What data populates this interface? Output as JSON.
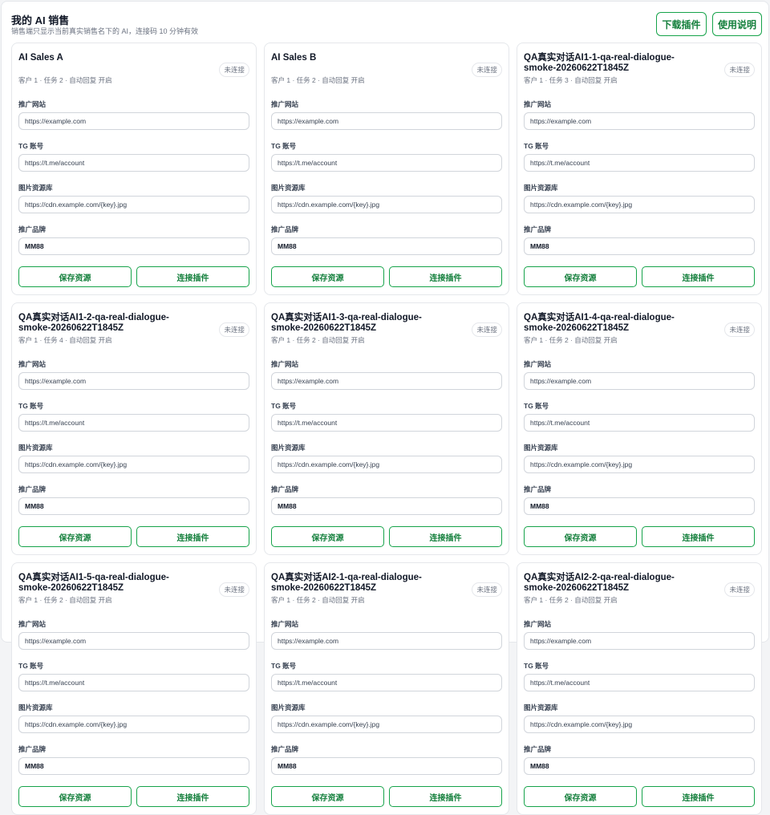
{
  "header": {
    "title": "我的 AI 销售",
    "subtitle": "销售端只显示当前真实销售名下的 AI，连接码 10 分钟有效",
    "download_label": "下载插件",
    "help_label": "使用说明"
  },
  "labels": {
    "promo_site": "推广网站",
    "tg_account": "TG 账号",
    "image_repo": "图片资源库",
    "brand": "推广品牌",
    "save": "保存资源",
    "connect": "连接插件"
  },
  "colors": {
    "accent": "#16a34a"
  },
  "cards": [
    {
      "title": "AI Sales A",
      "status": "未连接",
      "meta": "客户 1 · 任务 2 · 自动回复 开启",
      "site_placeholder": "https://example.com",
      "tg_placeholder": "https://t.me/account",
      "repo_placeholder": "https://cdn.example.com/{key}.jpg",
      "brand": "MM88"
    },
    {
      "title": "AI Sales B",
      "status": "未连接",
      "meta": "客户 1 · 任务 2 · 自动回复 开启",
      "site_placeholder": "https://example.com",
      "tg_placeholder": "https://t.me/account",
      "repo_placeholder": "https://cdn.example.com/{key}.jpg",
      "brand": "MM88"
    },
    {
      "title": "QA真实对话AI1-1-qa-real-dialogue-smoke-20260622T1845Z",
      "status": "未连接",
      "meta": "客户 1 · 任务 3 · 自动回复 开启",
      "site_placeholder": "https://example.com",
      "tg_placeholder": "https://t.me/account",
      "repo_placeholder": "https://cdn.example.com/{key}.jpg",
      "brand": "MM88"
    },
    {
      "title": "QA真实对话AI1-2-qa-real-dialogue-smoke-20260622T1845Z",
      "status": "未连接",
      "meta": "客户 1 · 任务 4 · 自动回复 开启",
      "site_placeholder": "https://example.com",
      "tg_placeholder": "https://t.me/account",
      "repo_placeholder": "https://cdn.example.com/{key}.jpg",
      "brand": "MM88"
    },
    {
      "title": "QA真实对话AI1-3-qa-real-dialogue-smoke-20260622T1845Z",
      "status": "未连接",
      "meta": "客户 1 · 任务 2 · 自动回复 开启",
      "site_placeholder": "https://example.com",
      "tg_placeholder": "https://t.me/account",
      "repo_placeholder": "https://cdn.example.com/{key}.jpg",
      "brand": "MM88"
    },
    {
      "title": "QA真实对话AI1-4-qa-real-dialogue-smoke-20260622T1845Z",
      "status": "未连接",
      "meta": "客户 1 · 任务 2 · 自动回复 开启",
      "site_placeholder": "https://example.com",
      "tg_placeholder": "https://t.me/account",
      "repo_placeholder": "https://cdn.example.com/{key}.jpg",
      "brand": "MM88"
    },
    {
      "title": "QA真实对话AI1-5-qa-real-dialogue-smoke-20260622T1845Z",
      "status": "未连接",
      "meta": "客户 1 · 任务 2 · 自动回复 开启",
      "site_placeholder": "https://example.com",
      "tg_placeholder": "https://t.me/account",
      "repo_placeholder": "https://cdn.example.com/{key}.jpg",
      "brand": "MM88"
    },
    {
      "title": "QA真实对话AI2-1-qa-real-dialogue-smoke-20260622T1845Z",
      "status": "未连接",
      "meta": "客户 1 · 任务 2 · 自动回复 开启",
      "site_placeholder": "https://example.com",
      "tg_placeholder": "https://t.me/account",
      "repo_placeholder": "https://cdn.example.com/{key}.jpg",
      "brand": "MM88"
    },
    {
      "title": "QA真实对话AI2-2-qa-real-dialogue-smoke-20260622T1845Z",
      "status": "未连接",
      "meta": "客户 1 · 任务 2 · 自动回复 开启",
      "site_placeholder": "https://example.com",
      "tg_placeholder": "https://t.me/account",
      "repo_placeholder": "https://cdn.example.com/{key}.jpg",
      "brand": "MM88"
    }
  ]
}
